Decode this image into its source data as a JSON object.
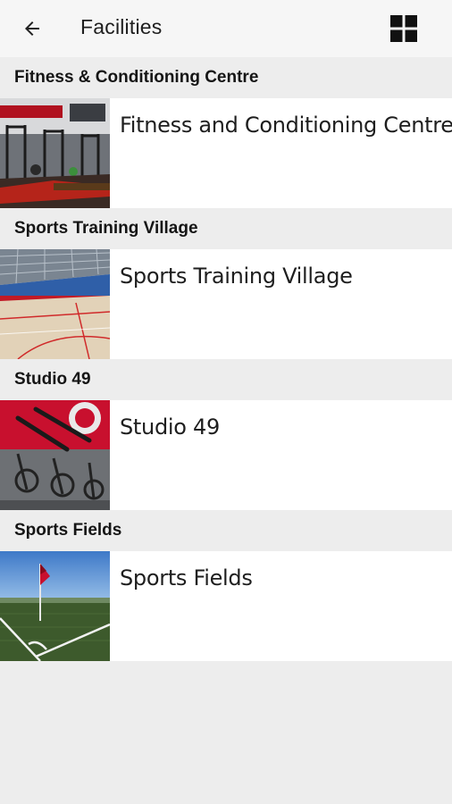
{
  "appbar": {
    "title": "Facilities",
    "back_icon": "arrow-left-icon",
    "view_icon": "grid-view-icon"
  },
  "sections": [
    {
      "header": "Fitness & Conditioning Centre",
      "item": {
        "label": "Fitness and Conditioning Centre",
        "thumb": "gym-equipment-photo"
      }
    },
    {
      "header": "Sports Training Village",
      "item": {
        "label": "Sports Training Village",
        "thumb": "indoor-sports-hall-photo"
      }
    },
    {
      "header": "Studio 49",
      "item": {
        "label": "Studio 49",
        "thumb": "spin-bikes-photo"
      }
    },
    {
      "header": "Sports Fields",
      "item": {
        "label": "Sports Fields",
        "thumb": "football-field-corner-flag-photo"
      }
    }
  ],
  "colors": {
    "appbar_bg": "#f6f6f6",
    "section_bg": "#ededed",
    "row_bg": "#ffffff",
    "accent_red": "#c8102e"
  }
}
